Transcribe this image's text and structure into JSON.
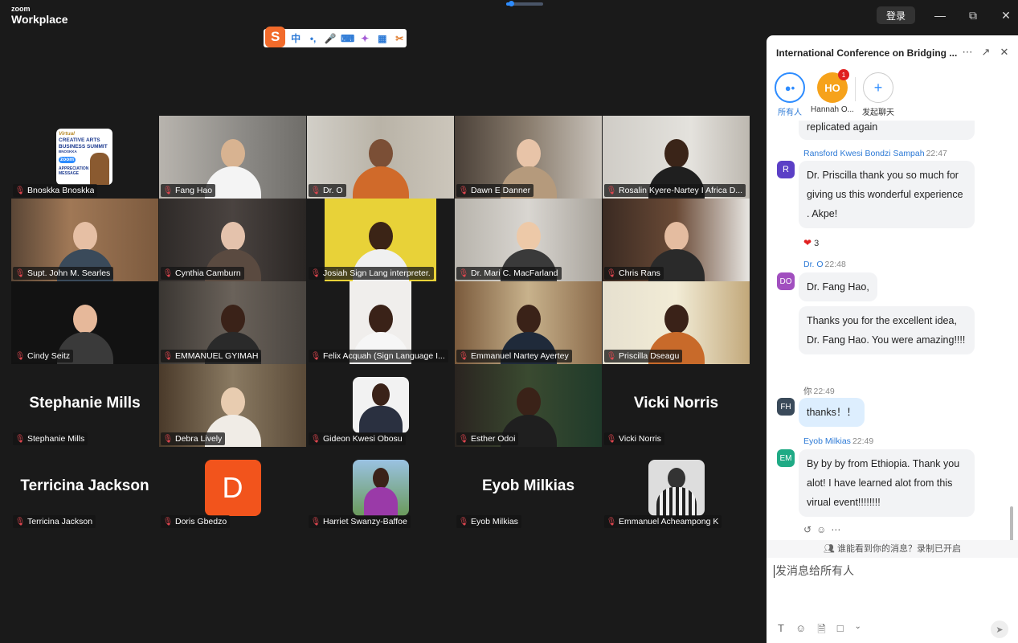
{
  "app": {
    "logo_top": "zoom",
    "logo_bottom": "Workplace",
    "login": "登录"
  },
  "meeting_progress": 0.12,
  "ime_toolbar": {
    "logo": "S",
    "items": [
      "中",
      "•,",
      "🎤",
      "⌨",
      "👕",
      "▦",
      "✂"
    ]
  },
  "participants": [
    {
      "name": "Bnoskka Bnoskka",
      "type": "avatar-image",
      "avatar_text": [
        "Virtual",
        "CREATIVE ARTS",
        "BUSINESS SUMMIT",
        "BNOSKKA",
        "zoom",
        "APPRECIATION",
        "MESSAGE"
      ]
    },
    {
      "name": "Fang Hao",
      "type": "video"
    },
    {
      "name": "Dr. O",
      "type": "video"
    },
    {
      "name": "Dawn E Danner",
      "type": "video"
    },
    {
      "name": "Rosalin Kyere-Nartey I Africa D...",
      "type": "video"
    },
    {
      "name": "Supt. John M. Searles",
      "type": "video"
    },
    {
      "name": "Cynthia Camburn",
      "type": "video"
    },
    {
      "name": "Josiah Sign Lang interpreter.",
      "type": "video"
    },
    {
      "name": "Dr. Mari C. MacFarland",
      "type": "video"
    },
    {
      "name": "Chris Rans",
      "type": "video"
    },
    {
      "name": "Cindy Seitz",
      "type": "video"
    },
    {
      "name": "EMMANUEL GYIMAH",
      "type": "video"
    },
    {
      "name": "Felix Acquah (Sign Language I...",
      "type": "video"
    },
    {
      "name": "Emmanuel Nartey Ayertey",
      "type": "video"
    },
    {
      "name": "Priscilla Dseagu",
      "type": "video",
      "active": true
    },
    {
      "name": "Stephanie Mills",
      "type": "name",
      "display": "Stephanie Mills"
    },
    {
      "name": "Debra Lively",
      "type": "video"
    },
    {
      "name": "Gideon Kwesi Obosu",
      "type": "avatar-image"
    },
    {
      "name": "Esther Odoi",
      "type": "video"
    },
    {
      "name": "Vicki Norris",
      "type": "name",
      "display": "Vicki Norris"
    },
    {
      "name": "Terricina Jackson",
      "type": "name",
      "display": "Terricina Jackson"
    },
    {
      "name": "Doris Gbedzo",
      "type": "letter",
      "letter": "D"
    },
    {
      "name": "Harriet Swanzy-Baffoe",
      "type": "avatar-image"
    },
    {
      "name": "Eyob Milkias",
      "type": "name",
      "display": "Eyob Milkias"
    },
    {
      "name": "Emmanuel Acheampong K",
      "type": "avatar-image"
    }
  ],
  "chat": {
    "title": "International Conference on Bridging ...",
    "recipients": [
      {
        "label": "所有人",
        "initials": "",
        "icon": "group-icon"
      },
      {
        "label": "Hannah O...",
        "initials": "HO",
        "badge": "1"
      },
      {
        "label": "发起聊天",
        "initials": "+",
        "icon": "plus-icon"
      }
    ],
    "messages": [
      {
        "sender": "",
        "time": "",
        "avatar": "",
        "lines": [
          "replicated again"
        ]
      },
      {
        "sender": "Ransford Kwesi Bondzi Sampah",
        "time": "22:47",
        "avatar": "R",
        "lines": [
          "Dr. Priscilla  thank you so much for giving us this wonderful experience . Akpe!"
        ],
        "reaction": "3"
      },
      {
        "sender": "Dr. O",
        "time": "22:48",
        "avatar": "DO",
        "lines": [
          "Dr. Fang Hao,",
          "Thanks you for the excellent idea, Dr. Fang Hao. You were amazing!!!!"
        ]
      },
      {
        "sender": "你",
        "time": "22:49",
        "avatar": "FH",
        "lines": [
          "thanks！！"
        ]
      },
      {
        "sender": "Eyob Milkias",
        "time": "22:49",
        "avatar": "EM",
        "lines": [
          "By by by from Ethiopia. Thank you alot! I have learned alot from this virual event!!!!!!!!"
        ]
      }
    ],
    "notice": "谁能看到你的消息？录制已开启",
    "input_placeholder": "发消息给所有人"
  },
  "colors": {
    "active_border": "#3ee08e",
    "accent": "#2d8cff",
    "doris_tile": "#f2541c",
    "hannah_avatar": "#f6a21b"
  }
}
